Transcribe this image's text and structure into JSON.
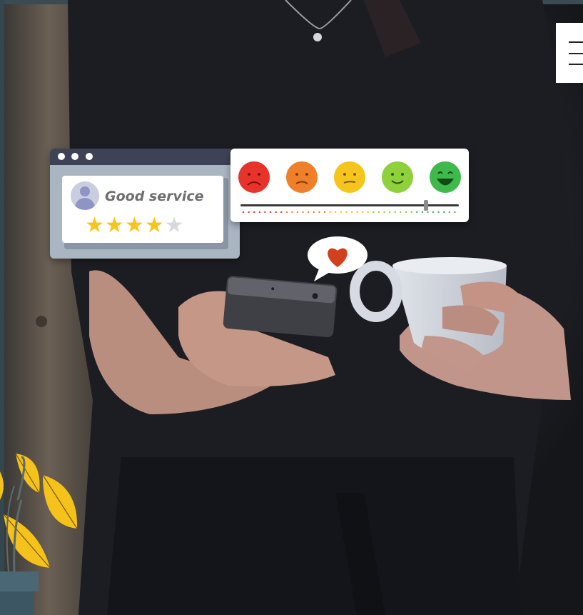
{
  "review_card": {
    "text": "Good service",
    "rating": 4,
    "max_rating": 5
  },
  "emoji_rating": {
    "faces": [
      "very-dissatisfied-face-icon",
      "dissatisfied-face-icon",
      "neutral-face-icon",
      "satisfied-face-icon",
      "very-satisfied-face-icon"
    ],
    "selected_level": 0.85
  },
  "menu": {
    "icon": "hamburger-menu-icon"
  },
  "colors": {
    "face_red": "#e8332b",
    "face_orange": "#f07f2a",
    "face_yellow": "#f6c51d",
    "face_lightgreen": "#8fd13b",
    "face_green": "#3fba4a",
    "heart": "#d0411e",
    "star": "#f9c41b"
  }
}
